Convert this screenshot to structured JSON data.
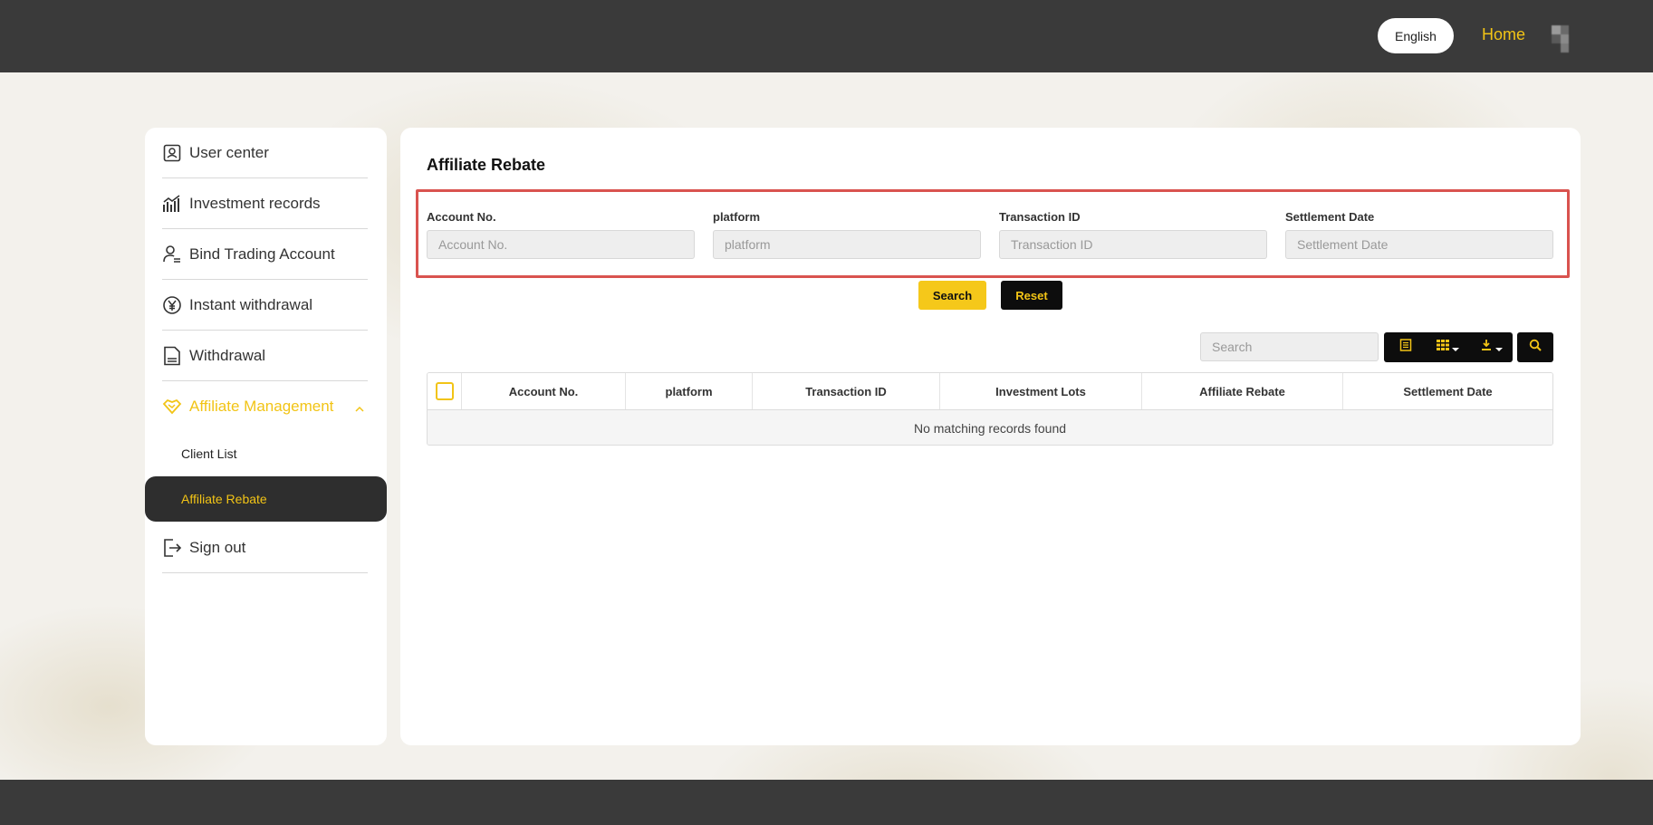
{
  "header": {
    "language_button": "English",
    "home_link": "Home"
  },
  "sidebar": {
    "items": [
      {
        "label": "User center",
        "icon": "user-card-icon"
      },
      {
        "label": "Investment records",
        "icon": "bar-chart-icon"
      },
      {
        "label": "Bind Trading Account",
        "icon": "user-bind-icon"
      },
      {
        "label": "Instant withdrawal",
        "icon": "yen-coin-icon"
      },
      {
        "label": "Withdrawal",
        "icon": "document-icon"
      },
      {
        "label": "Affiliate Management",
        "icon": "handshake-icon",
        "expanded": true
      },
      {
        "label": "Sign out",
        "icon": "sign-out-icon"
      }
    ],
    "sub_items": [
      {
        "label": "Client List",
        "active": false
      },
      {
        "label": "Affiliate Rebate",
        "active": true
      }
    ]
  },
  "main": {
    "title": "Affiliate Rebate",
    "filters": [
      {
        "label": "Account No.",
        "placeholder": "Account No."
      },
      {
        "label": "platform",
        "placeholder": "platform"
      },
      {
        "label": "Transaction ID",
        "placeholder": "Transaction ID"
      },
      {
        "label": "Settlement Date",
        "placeholder": "Settlement Date"
      }
    ],
    "search_button": "Search",
    "reset_button": "Reset",
    "table_search_placeholder": "Search",
    "table": {
      "columns": [
        "Account No.",
        "platform",
        "Transaction ID",
        "Investment Lots",
        "Affiliate Rebate",
        "Settlement Date"
      ],
      "empty_message": "No matching records found"
    }
  },
  "colors": {
    "accent": "#f2c416",
    "dark": "#3a3a3a",
    "highlight_border": "#d9534f"
  }
}
